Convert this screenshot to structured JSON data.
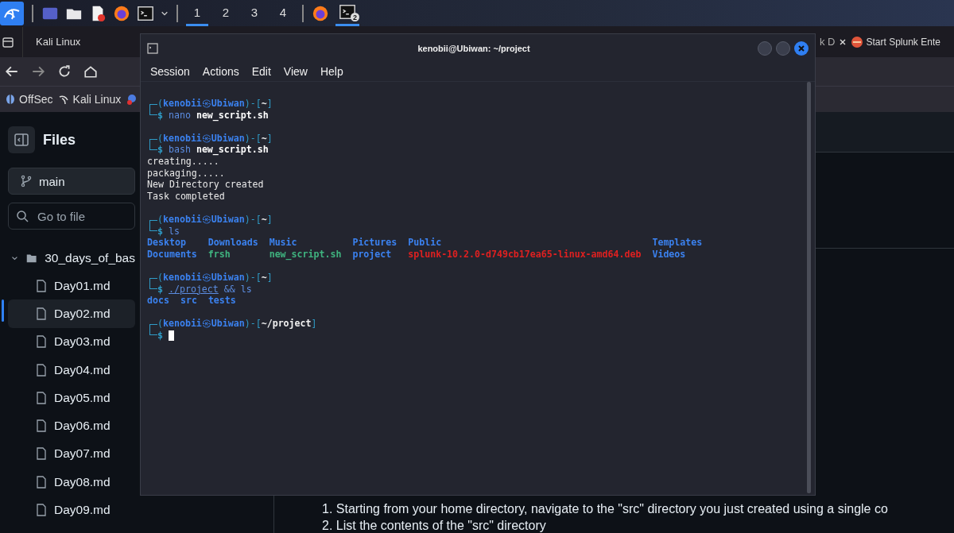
{
  "taskbar": {
    "workspaces": [
      {
        "label": "1",
        "selected": true
      },
      {
        "label": "2",
        "selected": false
      },
      {
        "label": "3",
        "selected": false
      },
      {
        "label": "4",
        "selected": false
      }
    ],
    "terminal_badge": "2"
  },
  "browser": {
    "tabs": [
      {
        "label": "Kali Linux",
        "kind": "folder",
        "selected": false
      },
      {
        "label": "k D",
        "kind": "partial",
        "selected": false
      },
      {
        "label": "Start Splunk Ente",
        "kind": "splunk",
        "selected": false
      }
    ],
    "bookmarks": [
      {
        "label": "OffSec",
        "kind": "offsec"
      },
      {
        "label": "Kali Linux",
        "kind": "kali"
      }
    ]
  },
  "sidebar": {
    "title": "Files",
    "branch": "main",
    "search": {
      "placeholder": "Go to file"
    },
    "folder": {
      "name": "30_days_of_bas",
      "expanded": true,
      "children": [
        {
          "name": "Day01.md",
          "selected": false
        },
        {
          "name": "Day02.md",
          "selected": true
        },
        {
          "name": "Day03.md",
          "selected": false
        },
        {
          "name": "Day04.md",
          "selected": false
        },
        {
          "name": "Day05.md",
          "selected": false
        },
        {
          "name": "Day06.md",
          "selected": false
        },
        {
          "name": "Day07.md",
          "selected": false
        },
        {
          "name": "Day08.md",
          "selected": false
        },
        {
          "name": "Day09.md",
          "selected": false
        }
      ]
    }
  },
  "content": {
    "list": [
      "1. Starting from your home directory, navigate to the \"src\" directory you just created using a single co",
      "2. List the contents of the \"src\" directory"
    ]
  },
  "terminal": {
    "title": "kenobii@Ubiwan: ~/project",
    "menu": [
      "Session",
      "Actions",
      "Edit",
      "View",
      "Help"
    ],
    "sessions": [
      {
        "prompt": [
          "(",
          "kenobii",
          "㉿",
          "Ubiwan",
          ")-[",
          "~",
          "]"
        ],
        "symbol": "$",
        "command": [
          {
            "text": "nano",
            "kind": "cmd"
          },
          {
            "text": "new_script.sh",
            "kind": "arg"
          }
        ]
      },
      {
        "prompt": [
          "(",
          "kenobii",
          "㉿",
          "Ubiwan",
          ")-[",
          "~",
          "]"
        ],
        "symbol": "$",
        "command": [
          {
            "text": "bash",
            "kind": "cmd"
          },
          {
            "text": "new_script.sh",
            "kind": "arg"
          }
        ],
        "output": [
          "creating.....",
          "packaging.....",
          "New Directory created",
          "Task completed"
        ]
      },
      {
        "prompt": [
          "(",
          "kenobii",
          "㉿",
          "Ubiwan",
          ")-[",
          "~",
          "]"
        ],
        "symbol": "$",
        "command": [
          {
            "text": "ls",
            "kind": "cmd"
          }
        ],
        "listing": [
          {
            "name": "Desktop",
            "kind": "dir"
          },
          {
            "name": "Documents",
            "kind": "dir"
          },
          {
            "name": "Downloads",
            "kind": "dir"
          },
          {
            "name": "frsh",
            "kind": "exec"
          },
          {
            "name": "Music",
            "kind": "dir"
          },
          {
            "name": "new_script.sh",
            "kind": "exec"
          },
          {
            "name": "Pictures",
            "kind": "dir"
          },
          {
            "name": "project",
            "kind": "dir"
          },
          {
            "name": "Public",
            "kind": "dir"
          },
          {
            "name": "splunk-10.2.0-d749cb17ea65-linux-amd64.deb",
            "kind": "package"
          },
          {
            "name": "Templates",
            "kind": "dir"
          },
          {
            "name": "Videos",
            "kind": "dir"
          }
        ]
      },
      {
        "prompt": [
          "(",
          "kenobii",
          "㉿",
          "Ubiwan",
          ")-[",
          "~",
          "]"
        ],
        "symbol": "$",
        "command": [
          {
            "text": "./project",
            "kind": "path"
          },
          {
            "text": "&&",
            "kind": "op"
          },
          {
            "text": "ls",
            "kind": "cmd"
          }
        ],
        "listing": [
          {
            "name": "docs",
            "kind": "dir"
          },
          {
            "name": "src",
            "kind": "dir"
          },
          {
            "name": "tests",
            "kind": "dir"
          }
        ]
      },
      {
        "prompt": [
          "(",
          "kenobii",
          "㉿",
          "Ubiwan",
          ")-[",
          "~/project",
          "]"
        ],
        "symbol": "$",
        "cursor": true
      }
    ]
  }
}
